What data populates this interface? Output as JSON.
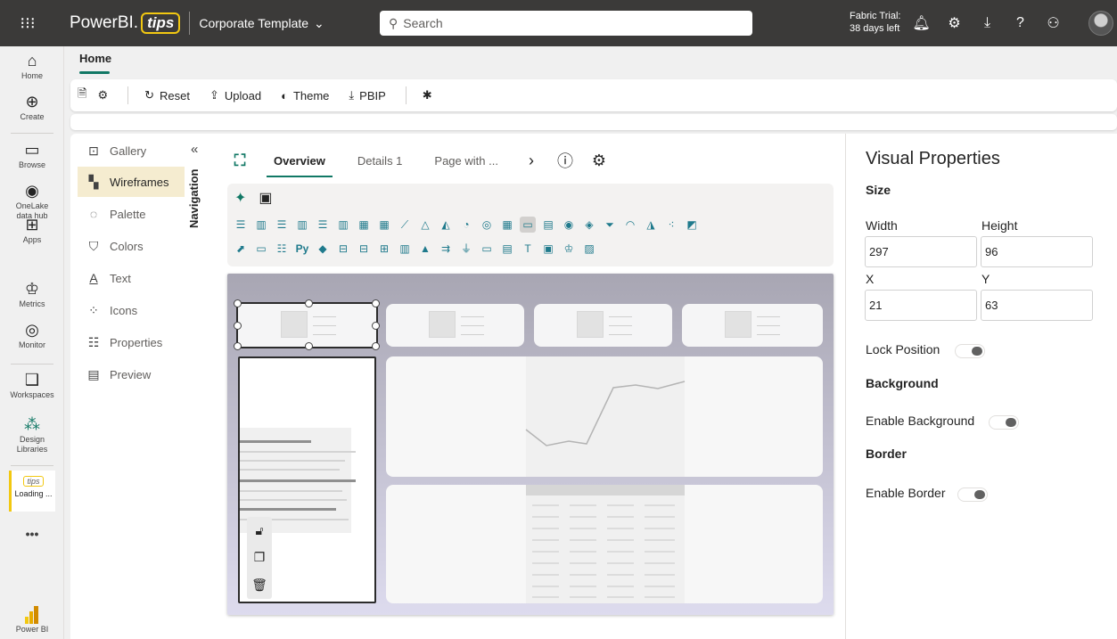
{
  "topbar": {
    "brand_main": "PowerBI.",
    "brand_tips": "tips",
    "workspace": "Corporate Template",
    "search_placeholder": "Search",
    "trial_line1": "Fabric Trial:",
    "trial_line2": "38 days left"
  },
  "leftnav": {
    "items": [
      {
        "label": "Home",
        "icon": "⌂"
      },
      {
        "label": "Create",
        "icon": "⊕"
      },
      {
        "label": "Browse",
        "icon": "▭"
      },
      {
        "label": "OneLake data hub",
        "icon": "◉"
      },
      {
        "label": "Apps",
        "icon": "⊞"
      },
      {
        "label": "Metrics",
        "icon": "♔"
      },
      {
        "label": "Monitor",
        "icon": "◎"
      },
      {
        "label": "Workspaces",
        "icon": "❑"
      },
      {
        "label": "Design Libraries",
        "icon": "⁂"
      }
    ],
    "tips_badge": "tips",
    "tips_label": "Loading ...",
    "more": "•••",
    "powerbi_label": "Power BI"
  },
  "ribbon": {
    "home_tab": "Home",
    "reset": "Reset",
    "upload": "Upload",
    "theme": "Theme",
    "pbip": "PBIP"
  },
  "navpane": {
    "title": "Navigation",
    "items": [
      {
        "label": "Gallery",
        "icon": "⊡"
      },
      {
        "label": "Wireframes",
        "icon": "▚"
      },
      {
        "label": "Palette",
        "icon": "◌"
      },
      {
        "label": "Colors",
        "icon": "⛉"
      },
      {
        "label": "Text",
        "icon": "A"
      },
      {
        "label": "Icons",
        "icon": "⁘"
      },
      {
        "label": "Properties",
        "icon": "☷"
      },
      {
        "label": "Preview",
        "icon": "▤"
      }
    ],
    "active": "Wireframes"
  },
  "canvas_tabs": {
    "tabs": [
      "Overview",
      "Details 1",
      "Page with ..."
    ],
    "active": "Overview"
  },
  "properties": {
    "title": "Visual Properties",
    "size_heading": "Size",
    "width_label": "Width",
    "height_label": "Height",
    "width_value": "297",
    "height_value": "96",
    "x_label": "X",
    "y_label": "Y",
    "x_value": "21",
    "y_value": "63",
    "lock_position": "Lock Position",
    "background_heading": "Background",
    "enable_background": "Enable Background",
    "border_heading": "Border",
    "enable_border": "Enable Border"
  },
  "colors": {
    "accent": "#117865",
    "brand_yellow": "#f2c811",
    "topbar": "#3b3a39"
  }
}
